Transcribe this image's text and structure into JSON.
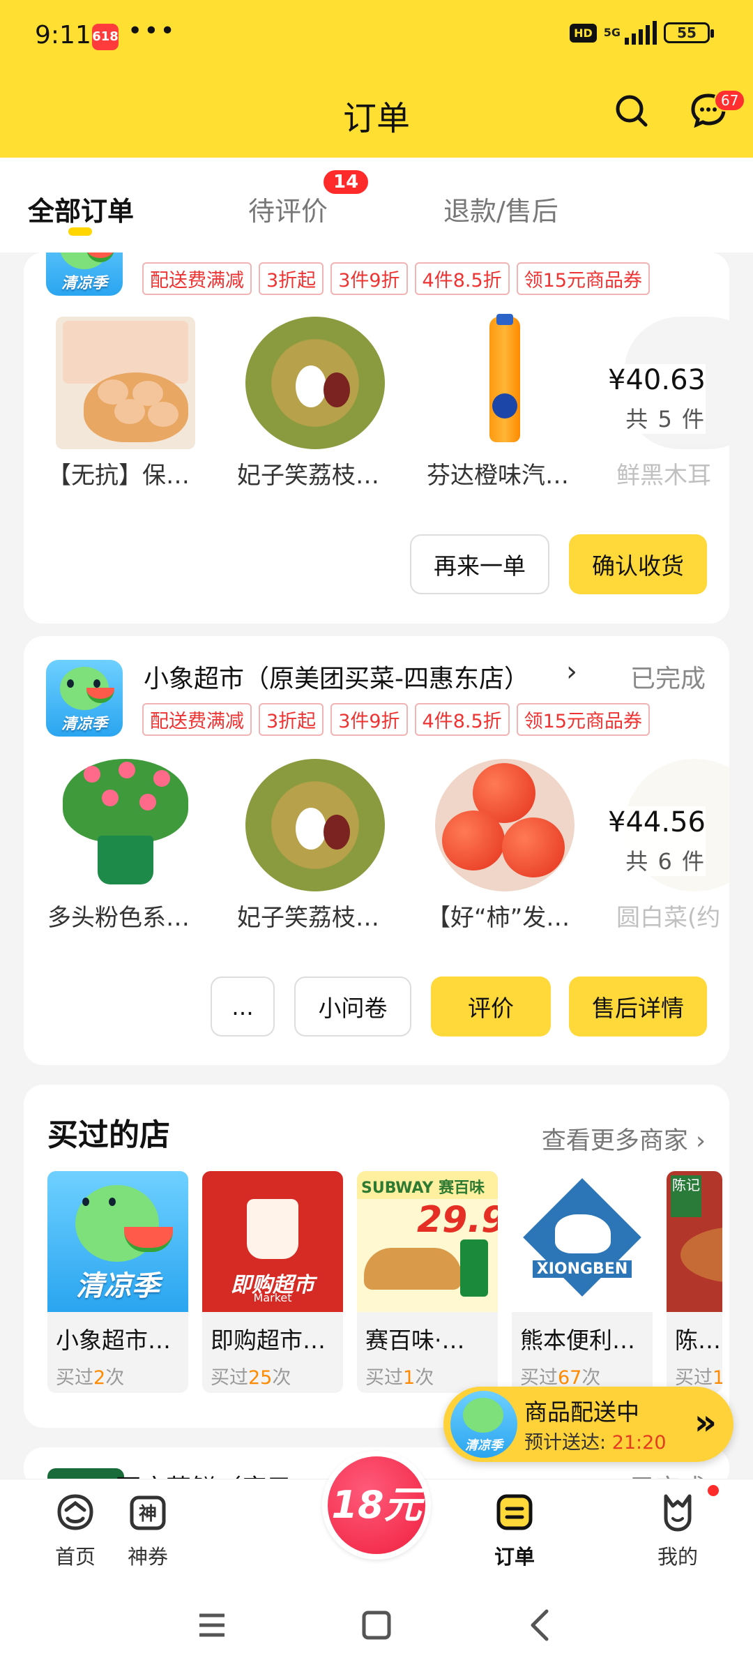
{
  "status_bar": {
    "time": "9:11",
    "app_badge": "618",
    "dots": "•••",
    "hd": "HD",
    "network": "5G",
    "battery": "55"
  },
  "header": {
    "title": "订单",
    "message_badge": "67"
  },
  "tabs": [
    {
      "label": "全部订单",
      "active": true
    },
    {
      "label": "待评价",
      "badge": "14"
    },
    {
      "label": "退款/售后"
    }
  ],
  "order1": {
    "logo_text": "清凉季",
    "tags": [
      "配送费满减",
      "3折起",
      "3件9折",
      "4件8.5折",
      "领15元商品券"
    ],
    "items": [
      "【无抗】保…",
      "妃子笑荔枝…",
      "芬达橙味汽…",
      "鲜黑木耳"
    ],
    "price": "¥40.63",
    "count": "共 5 件",
    "buttons": {
      "reorder": "再来一单",
      "confirm": "确认收货"
    }
  },
  "order2": {
    "logo_text": "清凉季",
    "shop_name": "小象超市（原美团买菜-四惠东店）",
    "status": "已完成",
    "tags": [
      "配送费满减",
      "3折起",
      "3件9折",
      "4件8.5折",
      "领15元商品券"
    ],
    "items": [
      "多头粉色系…",
      "妃子笑荔枝…",
      "【好“柿”发…",
      "圆白菜(约"
    ],
    "price": "¥44.56",
    "count": "共 6 件",
    "buttons": {
      "more": "...",
      "survey": "小问卷",
      "review": "评价",
      "aftersale": "售后详情"
    }
  },
  "stores": {
    "title": "买过的店",
    "more": "查看更多商家",
    "list": [
      {
        "name": "小象超市…",
        "prefix": "买过",
        "count": "2",
        "suffix": "次",
        "img_text": "清凉季"
      },
      {
        "name": "即购超市…",
        "prefix": "买过",
        "count": "25",
        "suffix": "次",
        "img_text": "即购超市",
        "img_sub": "Market"
      },
      {
        "name": "赛百味·…",
        "prefix": "买过",
        "count": "1",
        "suffix": "次",
        "img_text": "SUBWAY 赛百味",
        "img_price": "29.9"
      },
      {
        "name": "熊本便利…",
        "prefix": "买过",
        "count": "67",
        "suffix": "次",
        "img_text": "XIONGBEN"
      },
      {
        "name": "陈记",
        "prefix": "买过",
        "count": "1",
        "suffix": "",
        "img_text": "陈记"
      }
    ]
  },
  "delivery": {
    "logo_text": "清凉季",
    "title": "商品配送中",
    "eta_label": "预计送达:",
    "eta_time": "21:20"
  },
  "peek": {
    "name": "百店萃鲜（康元",
    "status": "已完成"
  },
  "bottom_nav": [
    {
      "label": "首页"
    },
    {
      "label": "神券",
      "icon_text": "神"
    },
    {
      "label": "18元"
    },
    {
      "label": "订单",
      "active": true
    },
    {
      "label": "我的"
    }
  ]
}
